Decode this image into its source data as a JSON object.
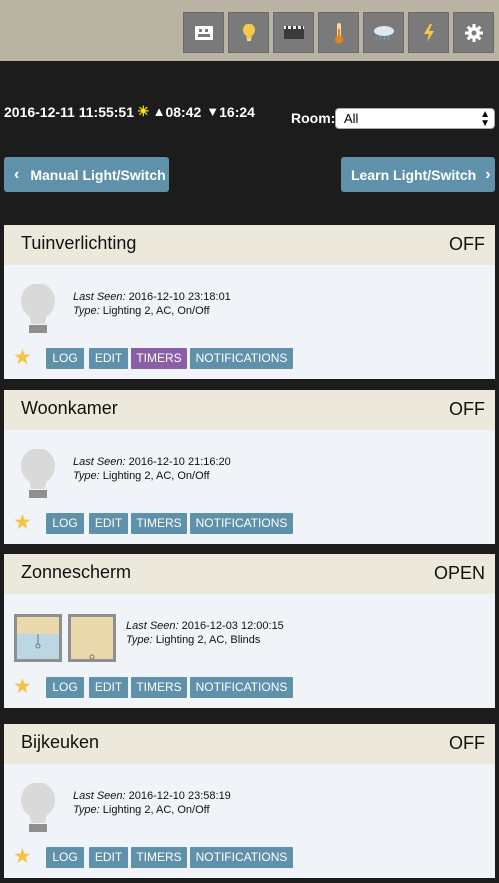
{
  "nav": {
    "items": [
      {
        "name": "dashboard-icon"
      },
      {
        "name": "lightbulb-icon"
      },
      {
        "name": "scenes-icon"
      },
      {
        "name": "thermometer-icon"
      },
      {
        "name": "weather-icon"
      },
      {
        "name": "lightning-icon"
      },
      {
        "name": "gear-icon"
      }
    ]
  },
  "status": {
    "datetime": "2016-12-11 11:55:51",
    "sun_symbol": "☀",
    "sunrise_symbol": "▲",
    "sunrise": "08:42",
    "sunset_symbol": "▼",
    "sunset": "16:24"
  },
  "room": {
    "label": "Room:",
    "selected": "All"
  },
  "actions": {
    "manual_label": "Manual Light/Switch",
    "learn_label": "Learn Light/Switch"
  },
  "devices": [
    {
      "name": "Tuinverlichting",
      "state": "OFF",
      "icon": "lightbulb-off-icon",
      "last_seen_label": "Last Seen:",
      "last_seen": "2016-12-10 23:18:01",
      "type_label": "Type:",
      "type": "Lighting 2, AC, On/Off",
      "buttons": {
        "log": "LOG",
        "edit": "EDIT",
        "timers": "TIMERS",
        "notifications": "NOTIFICATIONS"
      }
    },
    {
      "name": "Woonkamer",
      "state": "OFF",
      "icon": "lightbulb-off-icon",
      "last_seen_label": "Last Seen:",
      "last_seen": "2016-12-10 21:16:20",
      "type_label": "Type:",
      "type": "Lighting 2, AC, On/Off",
      "buttons": {
        "log": "LOG",
        "edit": "EDIT",
        "timers": "TIMERS",
        "notifications": "NOTIFICATIONS"
      }
    },
    {
      "name": "Zonnescherm",
      "state": "OPEN",
      "icon": "blinds-icon",
      "last_seen_label": "Last Seen:",
      "last_seen": "2016-12-03 12:00:15",
      "type_label": "Type:",
      "type": "Lighting 2, AC, Blinds",
      "buttons": {
        "log": "LOG",
        "edit": "EDIT",
        "timers": "TIMERS",
        "notifications": "NOTIFICATIONS"
      }
    },
    {
      "name": "Bijkeuken",
      "state": "OFF",
      "icon": "lightbulb-off-icon",
      "last_seen_label": "Last Seen:",
      "last_seen": "2016-12-10 23:58:19",
      "type_label": "Type:",
      "type": "Lighting 2, AC, On/Off",
      "buttons": {
        "log": "LOG",
        "edit": "EDIT",
        "timers": "TIMERS",
        "notifications": "NOTIFICATIONS"
      }
    }
  ],
  "colors": {
    "topbar": "#b8b3a2",
    "background": "#1c1c1c",
    "button_blue": "#5f91ab",
    "button_active_purple": "#8b5fa7",
    "favorite_star": "#f5c342",
    "card_header": "#ede8dc",
    "card_body": "#f0f3f8"
  }
}
